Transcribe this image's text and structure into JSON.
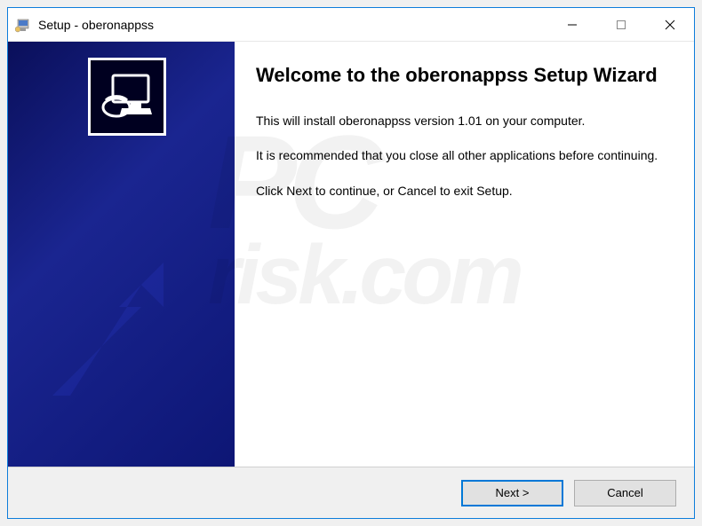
{
  "window": {
    "title": "Setup - oberonappss"
  },
  "wizard": {
    "heading": "Welcome to the oberonappss Setup Wizard",
    "para1": "This will install oberonappss version 1.01 on your computer.",
    "para2": "It is recommended that you close all other applications before continuing.",
    "para3": "Click Next to continue, or Cancel to exit Setup."
  },
  "buttons": {
    "next": "Next >",
    "cancel": "Cancel"
  },
  "watermark": {
    "line1": "PC",
    "line2": "risk.com"
  }
}
